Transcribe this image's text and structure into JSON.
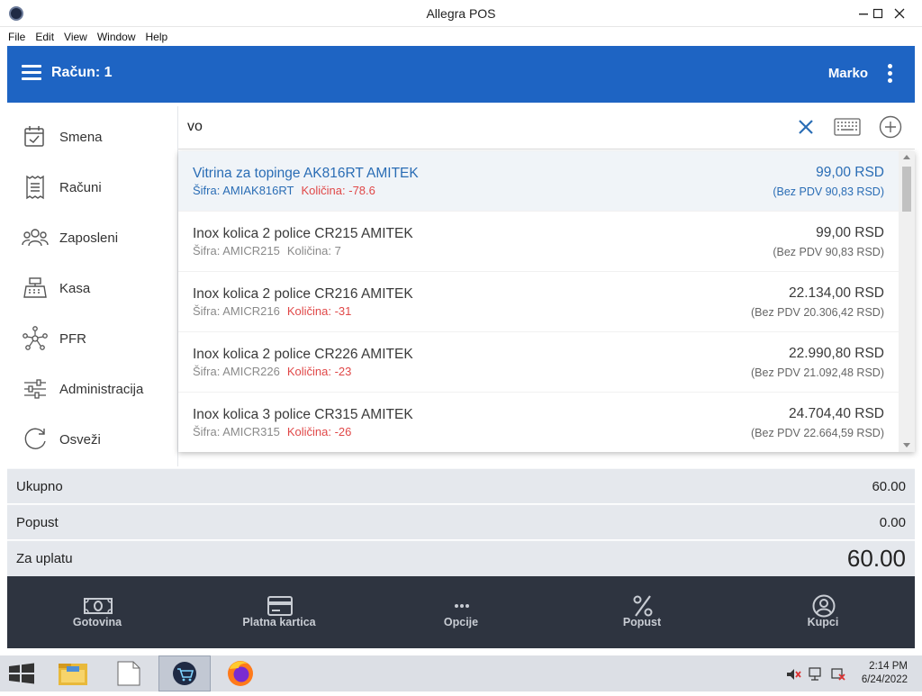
{
  "window": {
    "title": "Allegra POS"
  },
  "menu": [
    "File",
    "Edit",
    "View",
    "Window",
    "Help"
  ],
  "header": {
    "receipt_label": "Račun: 1",
    "user": "Marko"
  },
  "sidebar": {
    "items": [
      {
        "label": "Smena",
        "icon": "calendar-check-icon"
      },
      {
        "label": "Računi",
        "icon": "receipt-icon"
      },
      {
        "label": "Zaposleni",
        "icon": "people-icon"
      },
      {
        "label": "Kasa",
        "icon": "cash-register-icon"
      },
      {
        "label": "PFR",
        "icon": "network-icon"
      },
      {
        "label": "Administracija",
        "icon": "sliders-icon"
      },
      {
        "label": "Osveži",
        "icon": "refresh-icon"
      }
    ]
  },
  "search": {
    "value": "vo"
  },
  "results": [
    {
      "name": "Vitrina za topinge AK816RT AMITEK",
      "sku_label": "Šifra: AMIAK816RT",
      "qty_label": "Količina: -78.6",
      "qty_negative": true,
      "price": "99,00 RSD",
      "price_no_vat": "(Bez PDV 90,83 RSD)",
      "selected": true
    },
    {
      "name": "Inox kolica 2 police CR215 AMITEK",
      "sku_label": "Šifra: AMICR215",
      "qty_label": "Količina: 7",
      "qty_negative": false,
      "price": "99,00 RSD",
      "price_no_vat": "(Bez PDV 90,83 RSD)",
      "selected": false
    },
    {
      "name": "Inox kolica 2 police CR216 AMITEK",
      "sku_label": "Šifra: AMICR216",
      "qty_label": "Količina: -31",
      "qty_negative": true,
      "price": "22.134,00 RSD",
      "price_no_vat": "(Bez PDV 20.306,42 RSD)",
      "selected": false
    },
    {
      "name": "Inox kolica 2 police CR226 AMITEK",
      "sku_label": "Šifra: AMICR226",
      "qty_label": "Količina: -23",
      "qty_negative": true,
      "price": "22.990,80 RSD",
      "price_no_vat": "(Bez PDV 21.092,48 RSD)",
      "selected": false
    },
    {
      "name": "Inox kolica 3 police CR315 AMITEK",
      "sku_label": "Šifra: AMICR315",
      "qty_label": "Količina: -26",
      "qty_negative": true,
      "price": "24.704,40 RSD",
      "price_no_vat": "(Bez PDV 22.664,59 RSD)",
      "selected": false
    }
  ],
  "totals": {
    "total_label": "Ukupno",
    "total_value": "60.00",
    "discount_label": "Popust",
    "discount_value": "0.00",
    "due_label": "Za uplatu",
    "due_value": "60.00"
  },
  "actions": [
    {
      "label": "Gotovina",
      "icon": "cash-icon"
    },
    {
      "label": "Platna kartica",
      "icon": "credit-card-icon"
    },
    {
      "label": "Opcije",
      "icon": "more-horizontal-icon"
    },
    {
      "label": "Popust",
      "icon": "percent-icon"
    },
    {
      "label": "Kupci",
      "icon": "user-circle-icon"
    }
  ],
  "taskbar": {
    "time": "2:14 PM",
    "date": "6/24/2022"
  },
  "colors": {
    "header_bg": "#1e64c3",
    "action_bar_bg": "#2e3440",
    "negative_qty": "#e04848",
    "selected_text": "#2a6db5"
  }
}
